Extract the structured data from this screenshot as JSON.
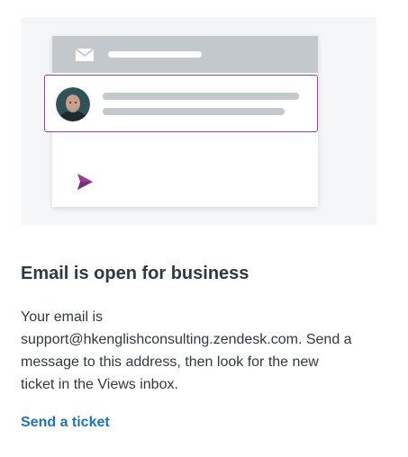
{
  "illustration": {
    "icons": [
      "envelope-icon",
      "avatar",
      "send-icon"
    ],
    "colors": {
      "background": "#f5f6f7",
      "header": "#c2c8cc",
      "accent": "#9b3f94",
      "placeholder_line": "#c2c8cc"
    }
  },
  "card": {
    "title": "Email is open for business",
    "description_lines": [
      "Your email is",
      "support@hkenglishconsulting.zendesk.com. Send a",
      "message to this address, then look for the new",
      "ticket in the Views inbox."
    ],
    "link_label": "Send a ticket",
    "link_color": "#1f73b7"
  }
}
